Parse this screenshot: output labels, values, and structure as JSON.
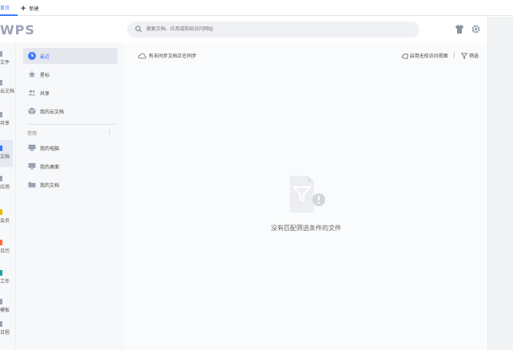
{
  "tabs": {
    "active_label": "首页",
    "new_label": "新建"
  },
  "header": {
    "logo": "WPS",
    "search_placeholder": "搜索文档、应用或粘贴访问网址"
  },
  "left_rail": {
    "items": [
      {
        "label": "文件"
      },
      {
        "label": "云文档"
      },
      {
        "label": "共享"
      },
      {
        "label": "文档"
      },
      {
        "label": "应用"
      },
      {
        "label": "会员"
      },
      {
        "label": "日历"
      },
      {
        "label": "工作"
      },
      {
        "label": "模板"
      },
      {
        "label": "日程"
      }
    ]
  },
  "sidebar": {
    "items": [
      {
        "label": "最近"
      },
      {
        "label": "星标"
      },
      {
        "label": "共享"
      },
      {
        "label": "我的云文档"
      }
    ],
    "section_title": "常用",
    "section_items": [
      {
        "label": "我的电脑"
      },
      {
        "label": "我的桌面"
      },
      {
        "label": "我的文档"
      }
    ]
  },
  "main": {
    "sync_label": "有未同步文档正在同步",
    "view_label": "启用无权访问视图",
    "filter_label": "筛选",
    "empty_text": "没有匹配筛选条件的文件"
  },
  "colors": {
    "accent": "#3a7afe",
    "sidebar_bg": "#f7f8fa",
    "main_bg": "#fafbfc"
  }
}
